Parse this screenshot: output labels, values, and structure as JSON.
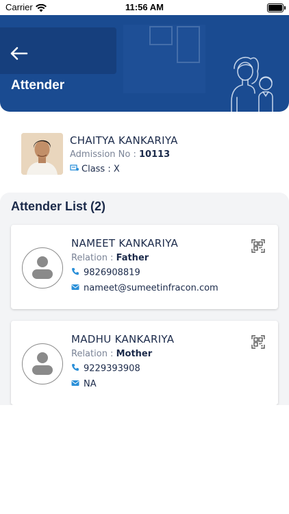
{
  "status_bar": {
    "carrier": "Carrier",
    "time": "11:56 AM"
  },
  "header": {
    "title": "Attender",
    "back_icon": "arrow-left-icon",
    "accent": "#1a4b91"
  },
  "student": {
    "name": "CHAITYA KANKARIYA",
    "admission_label": "Admission No : ",
    "admission_no": "10113",
    "class_label": "Class : ",
    "class_value": "X"
  },
  "attender_list": {
    "title": "Attender List (2)",
    "items": [
      {
        "name": "NAMEET KANKARIYA",
        "relation_label": "Relation : ",
        "relation": "Father",
        "phone": "9826908819",
        "email": "nameet@sumeetinfracon.com"
      },
      {
        "name": "MADHU KANKARIYA",
        "relation_label": "Relation : ",
        "relation": "Mother",
        "phone": "9229393908",
        "email": "NA"
      }
    ]
  },
  "colors": {
    "icon_blue": "#2a8fd8",
    "text_dark": "#1b2a4a",
    "text_muted": "#7a8396"
  }
}
